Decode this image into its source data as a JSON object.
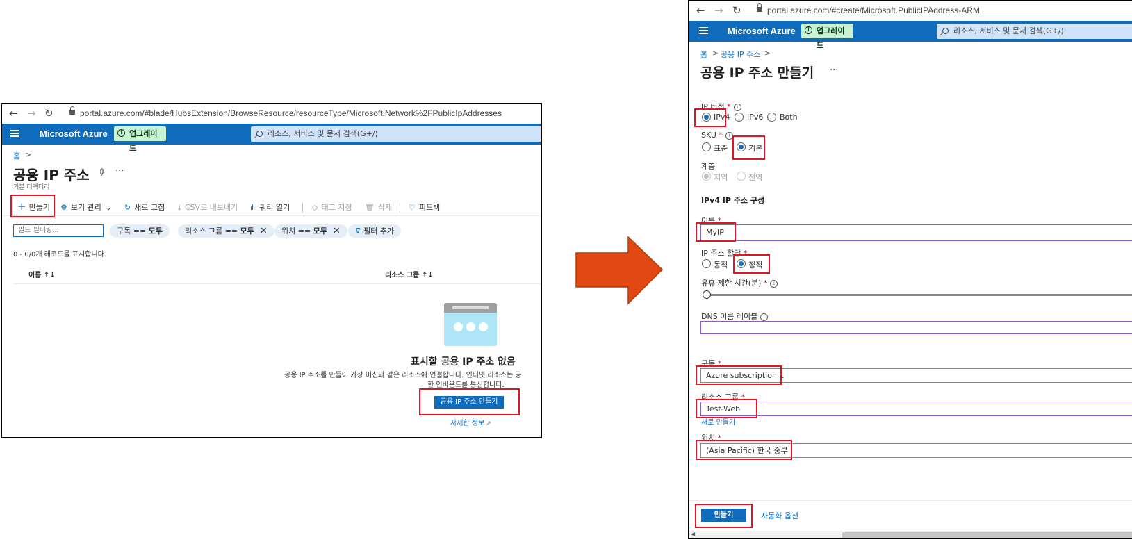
{
  "left": {
    "browser": {
      "url": "portal.azure.com/#blade/HubsExtension/BrowseResource/resourceType/Microsoft.Network%2FPublicIpAddresses"
    },
    "topbar": {
      "brand": "Microsoft Azure",
      "upgrade": "업그레이드",
      "search_placeholder": "리소스, 서비스 및 문서 검색(G+/)"
    },
    "breadcrumb": {
      "home": "홈",
      "sep": ">"
    },
    "page": {
      "title": "공용 IP 주소",
      "subtitle": "기본 디렉터리",
      "more": "···"
    },
    "toolbar": {
      "create": "만들기",
      "manage_view": "보기 관리",
      "refresh": "새로 고침",
      "export_csv": "CSV로 내보내기",
      "open_query": "쿼리 열기",
      "assign_tags": "태그 지정",
      "delete": "삭제",
      "feedback": "피드백"
    },
    "filters": {
      "field_placeholder": "필드 필터링...",
      "pills": [
        {
          "key": "구독 == ",
          "value": "모두"
        },
        {
          "key": "리소스 그룹 == ",
          "value": "모두"
        },
        {
          "key": "위치 == ",
          "value": "모두"
        }
      ],
      "add_filter": "필터 추가"
    },
    "record_count": "0 - 0/0개 레코드를 표시합니다.",
    "table": {
      "col_name": "이름 ↑↓",
      "col_rg": "리소스 그룹 ↑↓"
    },
    "empty": {
      "title": "표시할 공용 IP 주소 없음",
      "desc1": "공용 IP 주소를 만들어 가상 머신과 같은 리소스에 연결합니다. 인터넷 리소스는 공",
      "desc2": "한 인바운드를 통신합니다.",
      "create_button": "공용 IP 주소 만들기",
      "learn_more": "자세한 정보"
    }
  },
  "right": {
    "browser": {
      "url": "portal.azure.com/#create/Microsoft.PublicIPAddress-ARM"
    },
    "topbar": {
      "brand": "Microsoft Azure",
      "upgrade": "업그레이드",
      "search_placeholder": "리소스, 서비스 및 문서 검색(G+/)"
    },
    "breadcrumb": {
      "home": "홈",
      "sep1": ">",
      "item": "공용 IP 주소",
      "sep2": ">"
    },
    "page": {
      "title": "공용 IP 주소 만들기",
      "more": "···"
    },
    "ip_version": {
      "label": "IP 버전",
      "options": [
        {
          "label": "IPv4",
          "checked": true
        },
        {
          "label": "IPv6",
          "checked": false
        },
        {
          "label": "Both",
          "checked": false
        }
      ]
    },
    "sku": {
      "label": "SKU",
      "options": [
        {
          "label": "표준",
          "checked": false
        },
        {
          "label": "기본",
          "checked": true
        }
      ]
    },
    "tier": {
      "label": "계층",
      "options": [
        {
          "label": "지역",
          "checked": true
        },
        {
          "label": "전역",
          "checked": false
        }
      ]
    },
    "ipv4_section": "IPv4 IP 주소 구성",
    "name": {
      "label": "이름",
      "value": "MyIP"
    },
    "assignment": {
      "label": "IP 주소 할당",
      "options": [
        {
          "label": "동적",
          "checked": false
        },
        {
          "label": "정적",
          "checked": true
        }
      ]
    },
    "idle_timeout": {
      "label": "유휴 제한 시간(분)",
      "value": 4,
      "min": 4,
      "max": 30
    },
    "dns_label": {
      "label": "DNS 이름 레이블",
      "value": ""
    },
    "subscription": {
      "label": "구독",
      "value": "Azure subscription 1"
    },
    "resource_group": {
      "label": "리소스 그룹",
      "value": "Test-Web",
      "create_new": "새로 만들기"
    },
    "location": {
      "label": "위치",
      "value": "(Asia Pacific) 한국 중부"
    },
    "footer": {
      "create": "만들기",
      "automation": "자동화 옵션"
    },
    "required_mark": "*",
    "info_mark": "i"
  },
  "colors": {
    "azure_blue": "#0f6cbd",
    "highlight_red": "#e81123",
    "arrow_orange": "#e04a12"
  }
}
